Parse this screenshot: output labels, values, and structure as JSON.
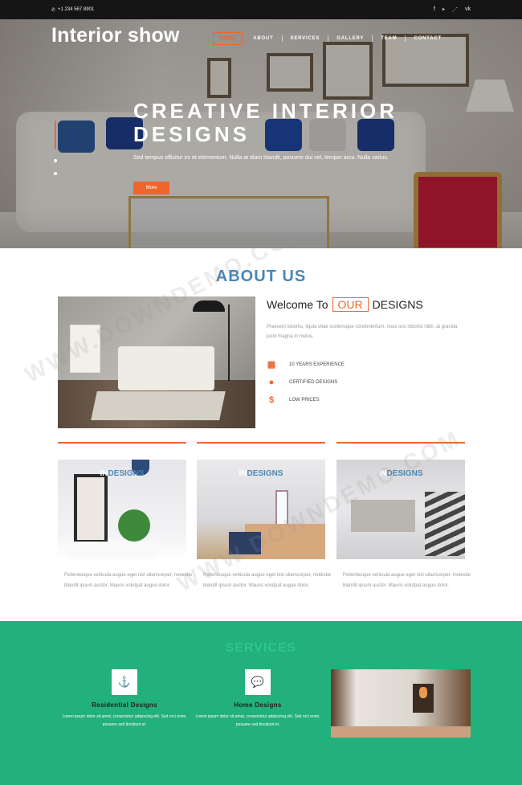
{
  "topbar": {
    "phone": "+1 234 567 8901",
    "social": [
      {
        "icon": "facebook-icon",
        "glyph": "f"
      },
      {
        "icon": "twitter-icon",
        "glyph": "🐦"
      },
      {
        "icon": "rss-icon",
        "glyph": "⋰"
      },
      {
        "icon": "vk-icon",
        "glyph": "vk"
      }
    ]
  },
  "header": {
    "logo": "Interior show",
    "nav": [
      "HOME",
      "ABOUT",
      "SERVICES",
      "GALLERY",
      "TEAM",
      "CONTACT"
    ],
    "active": "HOME"
  },
  "hero": {
    "title": "CREATIVE INTERIOR DESIGNS",
    "subtitle": "Sed tempus efficitur ex et elementum. Nulla at diam blandit, posuere dui vel, tempor arcu. Nulla varius.",
    "button": "More"
  },
  "about": {
    "title": "ABOUT US",
    "welcome_pre": "Welcome To",
    "welcome_highlight": "OUR",
    "welcome_post": "DESIGNS",
    "text": "Praesent lobortis, ligula vitae scelerisque condimentum, risus orci lobortis nibh, at gravida justo magna in metus.",
    "features": [
      {
        "icon": "calendar-icon",
        "glyph": "▦",
        "label": "10 YEARS EXPERIENCE"
      },
      {
        "icon": "certificate-icon",
        "glyph": "●",
        "label": "CERTIFIED DESIGNS"
      },
      {
        "icon": "dollar-icon",
        "glyph": "$",
        "label": "LOW PRICES"
      }
    ]
  },
  "cards": [
    {
      "label_a": "IN",
      "label_b": "DESIGNS",
      "text": "Pellentesque vehicula augue eget nisl ullamcorper, molestie blandit ipsum auctor. Mauris volutpat augue dolor."
    },
    {
      "label_a": "IN",
      "label_b": "DESIGNS",
      "text": "Pellentesque vehicula augue eget nisl ullamcorper, molestie blandit ipsum auctor. Mauris volutpat augue dolor."
    },
    {
      "label_a": "IN",
      "label_b": "DESIGNS",
      "text": "Pellentesque vehicula augue eget nisl ullamcorper, molestie blandit ipsum auctor. Mauris volutpat augue dolor."
    }
  ],
  "services": {
    "title": "SERVICES",
    "items": [
      {
        "icon": "anchor-icon",
        "glyph": "⚓",
        "title": "Residential Designs",
        "text": "Lorem ipsum dolor sit amet, consectetur adipiscing elit. Sed orci enim, posuere sed tincidunt et."
      },
      {
        "icon": "chat-icon",
        "glyph": "💬",
        "title": "Home Designs",
        "text": "Lorem ipsum dolor sit amet, consectetur adipiscing elit. Sed orci enim, posuere sed tincidunt et."
      }
    ]
  },
  "watermark": "WWW.DOWNDEMO.COM",
  "colors": {
    "accent": "#f0652c",
    "blue": "#4a86b5",
    "green": "#22b07d"
  }
}
